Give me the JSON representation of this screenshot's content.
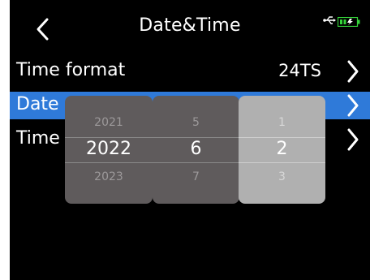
{
  "header": {
    "title": "Date&Time",
    "back_icon": "chevron-left-icon",
    "usb_icon": "usb-icon",
    "battery_icon": "battery-charging-icon",
    "usb_glyph": "⭠"
  },
  "rows": [
    {
      "label": "Time format",
      "value": "24TS"
    },
    {
      "label": "Date",
      "value": ""
    },
    {
      "label": "Time",
      "value": ""
    }
  ],
  "picker": {
    "year": {
      "prev": "2021",
      "current": "2022",
      "next": "2023"
    },
    "month": {
      "prev": "5",
      "current": "6",
      "next": "7"
    },
    "day": {
      "prev": "1",
      "current": "2",
      "next": "3"
    }
  },
  "colors": {
    "background": "#000000",
    "selected_row": "#2f7ad9",
    "picker_column": "#5f5b5c",
    "picker_active_column": "#b0b0b0",
    "battery_green": "#35d43a"
  }
}
